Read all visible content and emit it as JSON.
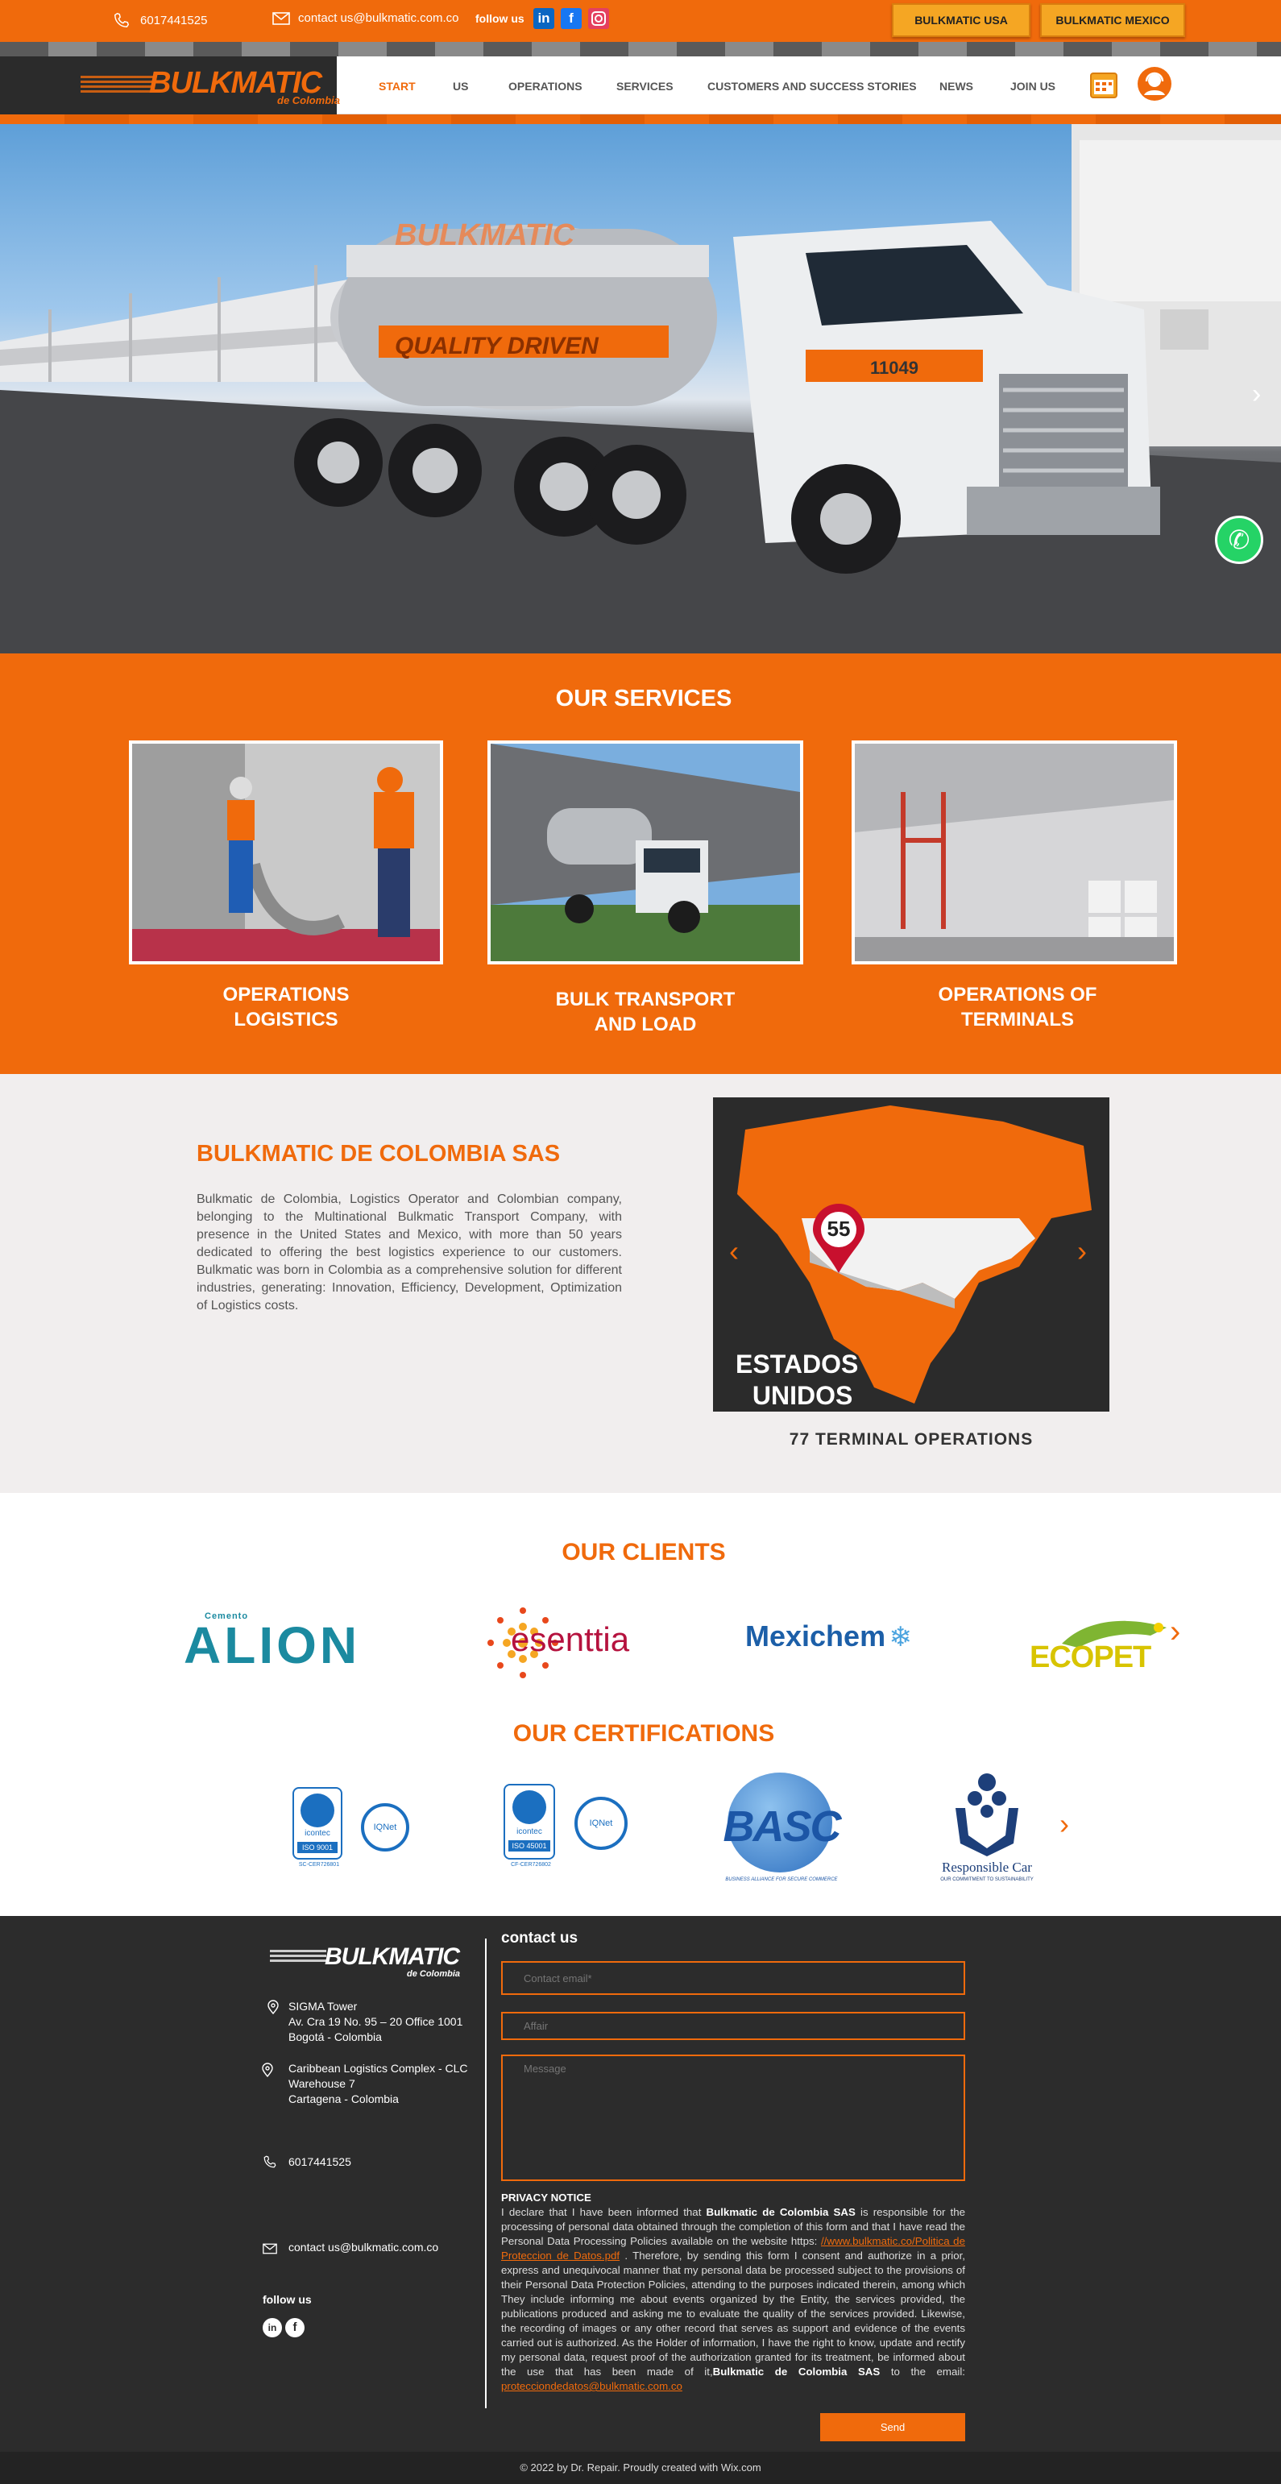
{
  "topbar": {
    "phone": "6017441525",
    "email": "contact us@bulkmatic.com.co",
    "follow_label": "follow us",
    "social_icons": [
      "linkedin-icon",
      "facebook-icon",
      "instagram-icon"
    ],
    "btn_usa": "BULKMATIC USA",
    "btn_mexico": "BULKMATIC MEXICO"
  },
  "brand": {
    "name": "BULKMATIC",
    "sub": "de Colombia",
    "accent": "#f06a0c"
  },
  "nav": {
    "items": [
      "START",
      "US",
      "OPERATIONS",
      "SERVICES",
      "CUSTOMERS AND SUCCESS STORIES",
      "NEWS",
      "JOIN US"
    ],
    "active": "START"
  },
  "hero": {
    "truck_text": "QUALITY DRIVEN",
    "truck_number": "11049"
  },
  "services": {
    "title": "OUR SERVICES",
    "items": [
      {
        "label": "OPERATIONS\nLOGISTICS"
      },
      {
        "label": "BULK TRANSPORT\nAND LOAD"
      },
      {
        "label": "OPERATIONS OF\nTERMINALS"
      }
    ]
  },
  "about": {
    "title": "BULKMATIC DE COLOMBIA SAS",
    "text": "Bulkmatic de Colombia, Logistics Operator and Colombian company, belonging to the Multinational Bulkmatic Transport Company, with presence in the United States and Mexico, with more than 50 years dedicated to offering the best logistics experience to our customers. Bulkmatic was born in Colombia as a comprehensive solution for different industries, generating: Innovation, Efficiency, Development, Optimization of Logistics costs.",
    "map_pin": "55",
    "map_label": "ESTADOS\nUNIDOS",
    "map_caption": "77 TERMINAL OPERATIONS"
  },
  "clients": {
    "title": "OUR CLIENTS",
    "logos": [
      {
        "small": "Cemento",
        "name": "ALION"
      },
      {
        "name": "esenttia"
      },
      {
        "name": "Mexichem"
      },
      {
        "name": "ECOPET"
      }
    ]
  },
  "certifications": {
    "title": "OUR CERTIFICATIONS",
    "items": [
      {
        "name": "icontec",
        "code": "ISO 9001",
        "net": "IQNet",
        "id": "SC-CER726801"
      },
      {
        "name": "icontec",
        "code": "ISO 45001",
        "net": "IQNet",
        "id": "CF-CER726802"
      },
      {
        "name": "BASC",
        "caption": "BUSINESS ALLIANCE FOR SECURE COMMERCE"
      },
      {
        "name": "Responsible Car",
        "caption": "OUR COMMITMENT TO SUSTAINABILITY"
      }
    ]
  },
  "footer": {
    "logo": "BULKMATIC",
    "logo_sub": "de Colombia",
    "address1": [
      "SIGMA Tower",
      "Av. Cra 19 No. 95 – 20 Office 1001",
      "Bogotá - Colombia"
    ],
    "address2": [
      "Caribbean Logistics Complex - CLC",
      "Warehouse 7",
      "Cartagena - Colombia"
    ],
    "phone": "6017441525",
    "email": "contact us@bulkmatic.com.co",
    "follow": "follow us",
    "contact_title": "contact us",
    "form": {
      "email_placeholder": "Contact email*",
      "affair_placeholder": "Affair",
      "message_placeholder": "Message",
      "send": "Send"
    },
    "privacy_title": "PRIVACY NOTICE",
    "privacy_p1": "I declare that I have been informed that ",
    "privacy_company": "Bulkmatic de Colombia SAS",
    "privacy_p2": " is responsible for the processing of personal data obtained through the completion of this form and that I have read the Personal Data Processing Policies available on the website https:",
    "privacy_link": "//www.bulkmatic.co/Politica de Proteccion de Datos.pdf",
    "privacy_p3": " . Therefore, by sending this form I consent and authorize in a prior, express and unequivocal manner that my personal data be processed subject to the provisions of their Personal Data Protection Policies, attending to the purposes indicated therein, among which They include informing me about events organized by the Entity, the services provided, the publications produced and asking me to evaluate the quality of the services provided. Likewise, the recording of images or any other record that serves as support and evidence of the events carried out is authorized. As the Holder of information, I have the right to know, update and rectify my personal data, request proof of the authorization granted for its treatment, be informed about the use that has been made of it,",
    "privacy_company2": "Bulkmatic de Colombia SAS",
    "privacy_p4": " to the email: ",
    "privacy_email": "protecciondedatos@bulkmatic.com.co",
    "credit": "© 2022 by Dr. Repair. Proudly created with  Wix.com"
  }
}
